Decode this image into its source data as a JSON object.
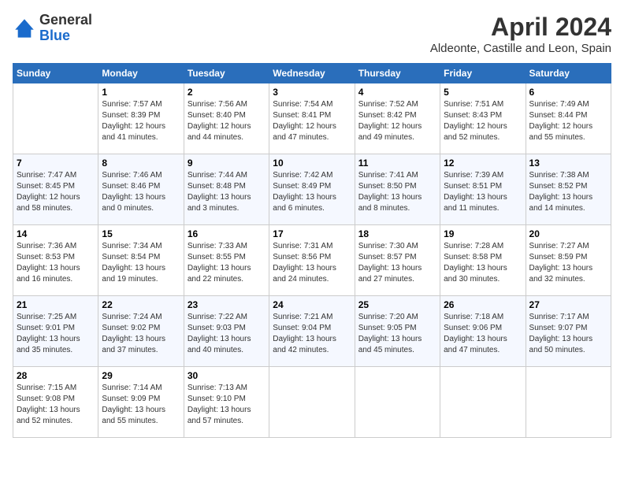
{
  "app": {
    "name_general": "General",
    "name_blue": "Blue"
  },
  "header": {
    "title": "April 2024",
    "subtitle": "Aldeonte, Castille and Leon, Spain"
  },
  "days_of_week": [
    "Sunday",
    "Monday",
    "Tuesday",
    "Wednesday",
    "Thursday",
    "Friday",
    "Saturday"
  ],
  "weeks": [
    [
      {
        "day": "",
        "sunrise": "",
        "sunset": "",
        "daylight": ""
      },
      {
        "day": "1",
        "sunrise": "Sunrise: 7:57 AM",
        "sunset": "Sunset: 8:39 PM",
        "daylight": "Daylight: 12 hours and 41 minutes."
      },
      {
        "day": "2",
        "sunrise": "Sunrise: 7:56 AM",
        "sunset": "Sunset: 8:40 PM",
        "daylight": "Daylight: 12 hours and 44 minutes."
      },
      {
        "day": "3",
        "sunrise": "Sunrise: 7:54 AM",
        "sunset": "Sunset: 8:41 PM",
        "daylight": "Daylight: 12 hours and 47 minutes."
      },
      {
        "day": "4",
        "sunrise": "Sunrise: 7:52 AM",
        "sunset": "Sunset: 8:42 PM",
        "daylight": "Daylight: 12 hours and 49 minutes."
      },
      {
        "day": "5",
        "sunrise": "Sunrise: 7:51 AM",
        "sunset": "Sunset: 8:43 PM",
        "daylight": "Daylight: 12 hours and 52 minutes."
      },
      {
        "day": "6",
        "sunrise": "Sunrise: 7:49 AM",
        "sunset": "Sunset: 8:44 PM",
        "daylight": "Daylight: 12 hours and 55 minutes."
      }
    ],
    [
      {
        "day": "7",
        "sunrise": "Sunrise: 7:47 AM",
        "sunset": "Sunset: 8:45 PM",
        "daylight": "Daylight: 12 hours and 58 minutes."
      },
      {
        "day": "8",
        "sunrise": "Sunrise: 7:46 AM",
        "sunset": "Sunset: 8:46 PM",
        "daylight": "Daylight: 13 hours and 0 minutes."
      },
      {
        "day": "9",
        "sunrise": "Sunrise: 7:44 AM",
        "sunset": "Sunset: 8:48 PM",
        "daylight": "Daylight: 13 hours and 3 minutes."
      },
      {
        "day": "10",
        "sunrise": "Sunrise: 7:42 AM",
        "sunset": "Sunset: 8:49 PM",
        "daylight": "Daylight: 13 hours and 6 minutes."
      },
      {
        "day": "11",
        "sunrise": "Sunrise: 7:41 AM",
        "sunset": "Sunset: 8:50 PM",
        "daylight": "Daylight: 13 hours and 8 minutes."
      },
      {
        "day": "12",
        "sunrise": "Sunrise: 7:39 AM",
        "sunset": "Sunset: 8:51 PM",
        "daylight": "Daylight: 13 hours and 11 minutes."
      },
      {
        "day": "13",
        "sunrise": "Sunrise: 7:38 AM",
        "sunset": "Sunset: 8:52 PM",
        "daylight": "Daylight: 13 hours and 14 minutes."
      }
    ],
    [
      {
        "day": "14",
        "sunrise": "Sunrise: 7:36 AM",
        "sunset": "Sunset: 8:53 PM",
        "daylight": "Daylight: 13 hours and 16 minutes."
      },
      {
        "day": "15",
        "sunrise": "Sunrise: 7:34 AM",
        "sunset": "Sunset: 8:54 PM",
        "daylight": "Daylight: 13 hours and 19 minutes."
      },
      {
        "day": "16",
        "sunrise": "Sunrise: 7:33 AM",
        "sunset": "Sunset: 8:55 PM",
        "daylight": "Daylight: 13 hours and 22 minutes."
      },
      {
        "day": "17",
        "sunrise": "Sunrise: 7:31 AM",
        "sunset": "Sunset: 8:56 PM",
        "daylight": "Daylight: 13 hours and 24 minutes."
      },
      {
        "day": "18",
        "sunrise": "Sunrise: 7:30 AM",
        "sunset": "Sunset: 8:57 PM",
        "daylight": "Daylight: 13 hours and 27 minutes."
      },
      {
        "day": "19",
        "sunrise": "Sunrise: 7:28 AM",
        "sunset": "Sunset: 8:58 PM",
        "daylight": "Daylight: 13 hours and 30 minutes."
      },
      {
        "day": "20",
        "sunrise": "Sunrise: 7:27 AM",
        "sunset": "Sunset: 8:59 PM",
        "daylight": "Daylight: 13 hours and 32 minutes."
      }
    ],
    [
      {
        "day": "21",
        "sunrise": "Sunrise: 7:25 AM",
        "sunset": "Sunset: 9:01 PM",
        "daylight": "Daylight: 13 hours and 35 minutes."
      },
      {
        "day": "22",
        "sunrise": "Sunrise: 7:24 AM",
        "sunset": "Sunset: 9:02 PM",
        "daylight": "Daylight: 13 hours and 37 minutes."
      },
      {
        "day": "23",
        "sunrise": "Sunrise: 7:22 AM",
        "sunset": "Sunset: 9:03 PM",
        "daylight": "Daylight: 13 hours and 40 minutes."
      },
      {
        "day": "24",
        "sunrise": "Sunrise: 7:21 AM",
        "sunset": "Sunset: 9:04 PM",
        "daylight": "Daylight: 13 hours and 42 minutes."
      },
      {
        "day": "25",
        "sunrise": "Sunrise: 7:20 AM",
        "sunset": "Sunset: 9:05 PM",
        "daylight": "Daylight: 13 hours and 45 minutes."
      },
      {
        "day": "26",
        "sunrise": "Sunrise: 7:18 AM",
        "sunset": "Sunset: 9:06 PM",
        "daylight": "Daylight: 13 hours and 47 minutes."
      },
      {
        "day": "27",
        "sunrise": "Sunrise: 7:17 AM",
        "sunset": "Sunset: 9:07 PM",
        "daylight": "Daylight: 13 hours and 50 minutes."
      }
    ],
    [
      {
        "day": "28",
        "sunrise": "Sunrise: 7:15 AM",
        "sunset": "Sunset: 9:08 PM",
        "daylight": "Daylight: 13 hours and 52 minutes."
      },
      {
        "day": "29",
        "sunrise": "Sunrise: 7:14 AM",
        "sunset": "Sunset: 9:09 PM",
        "daylight": "Daylight: 13 hours and 55 minutes."
      },
      {
        "day": "30",
        "sunrise": "Sunrise: 7:13 AM",
        "sunset": "Sunset: 9:10 PM",
        "daylight": "Daylight: 13 hours and 57 minutes."
      },
      {
        "day": "",
        "sunrise": "",
        "sunset": "",
        "daylight": ""
      },
      {
        "day": "",
        "sunrise": "",
        "sunset": "",
        "daylight": ""
      },
      {
        "day": "",
        "sunrise": "",
        "sunset": "",
        "daylight": ""
      },
      {
        "day": "",
        "sunrise": "",
        "sunset": "",
        "daylight": ""
      }
    ]
  ]
}
